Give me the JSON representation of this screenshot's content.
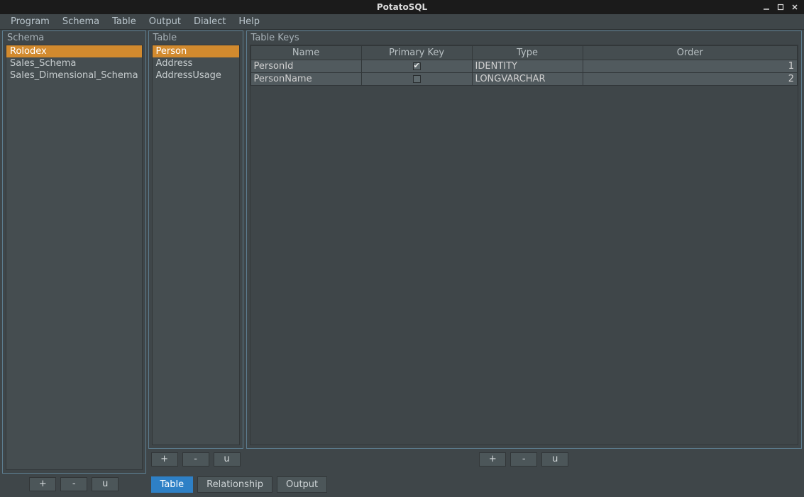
{
  "window": {
    "title": "PotatoSQL"
  },
  "menubar": {
    "items": [
      "Program",
      "Schema",
      "Table",
      "Output",
      "Dialect",
      "Help"
    ]
  },
  "schema_panel": {
    "title": "Schema",
    "items": [
      {
        "label": "Rolodex",
        "selected": true
      },
      {
        "label": "Sales_Schema",
        "selected": false
      },
      {
        "label": "Sales_Dimensional_Schema",
        "selected": false
      }
    ],
    "buttons": {
      "add": "+",
      "remove": "-",
      "update": "u"
    }
  },
  "table_panel": {
    "title": "Table",
    "items": [
      {
        "label": "Person",
        "selected": true
      },
      {
        "label": "Address",
        "selected": false
      },
      {
        "label": "AddressUsage",
        "selected": false
      }
    ],
    "buttons": {
      "add": "+",
      "remove": "-",
      "update": "u"
    }
  },
  "keys_panel": {
    "title": "Table Keys",
    "columns": [
      "Name",
      "Primary Key",
      "Type",
      "Order"
    ],
    "rows": [
      {
        "name": "PersonId",
        "primary": true,
        "type": "IDENTITY",
        "order": "1"
      },
      {
        "name": "PersonName",
        "primary": false,
        "type": "LONGVARCHAR",
        "order": "2"
      }
    ],
    "buttons": {
      "add": "+",
      "remove": "-",
      "update": "u"
    }
  },
  "tabs": {
    "items": [
      {
        "label": "Table",
        "active": true
      },
      {
        "label": "Relationship",
        "active": false
      },
      {
        "label": "Output",
        "active": false
      }
    ]
  }
}
